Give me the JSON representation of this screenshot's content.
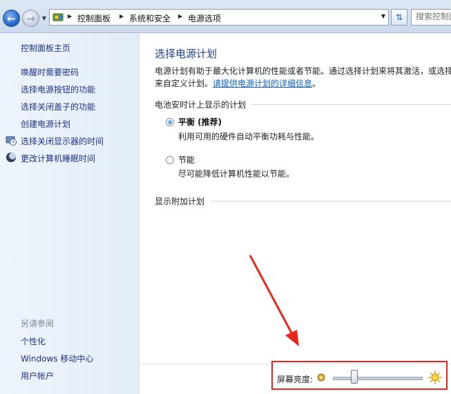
{
  "address_bar": {
    "breadcrumbs": [
      "控制面板",
      "系统和安全",
      "电源选项"
    ],
    "search_placeholder": "搜索控制面"
  },
  "sidebar": {
    "home": "控制面板主页",
    "links": [
      "唤醒时需要密码",
      "选择电源按钮的功能",
      "选择关闭盖子的功能",
      "创建电源计划",
      "选择关闭显示器的时间",
      "更改计算机睡眠时间"
    ],
    "see_also_heading": "另请参阅",
    "see_also": [
      "个性化",
      "Windows 移动中心",
      "用户帐户"
    ]
  },
  "main": {
    "title": "选择电源计划",
    "intro_line1": "电源计划有助于最大化计算机的性能或者节能。通过选择计划来将其激活，或选择",
    "intro_line2_prefix": "来自定义计划。",
    "intro_link": "请提供电源计划的详细信息",
    "intro_line2_suffix": "。",
    "battery_group": "电池安时计上显示的计划",
    "plans": [
      {
        "name": "平衡 (推荐)",
        "desc": "利用可用的硬件自动平衡功耗与性能。",
        "selected": true
      },
      {
        "name": "节能",
        "desc": "尽可能降低计算机性能以节能。",
        "selected": false
      }
    ],
    "extra_group": "显示附加计划",
    "brightness_label": "屏幕亮度:",
    "brightness_level": 0.24
  },
  "colors": {
    "link": "#1e3287",
    "title": "#1e3f90",
    "annotation_red": "#e8261c"
  }
}
